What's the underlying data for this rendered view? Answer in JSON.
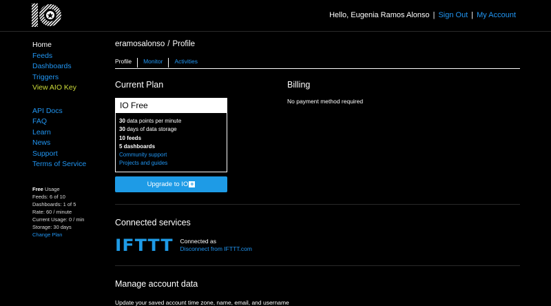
{
  "header": {
    "greeting": "Hello, Eugenia Ramos Alonso",
    "sign_out": "Sign Out",
    "my_account": "My Account",
    "separator": "|"
  },
  "sidebar": {
    "nav": [
      {
        "label": "Home"
      },
      {
        "label": "Feeds"
      },
      {
        "label": "Dashboards"
      },
      {
        "label": "Triggers"
      },
      {
        "label": "View AIO Key"
      }
    ],
    "nav2": [
      {
        "label": "API Docs"
      },
      {
        "label": "FAQ"
      },
      {
        "label": "Learn"
      },
      {
        "label": "News"
      },
      {
        "label": "Support"
      },
      {
        "label": "Terms of Service"
      }
    ],
    "usage": {
      "plan": "Free",
      "title": "Usage",
      "feeds": "Feeds: 6 of 10",
      "dashboards": "Dashboards: 1 of 5",
      "rate": "Rate: 60 / minute",
      "current": "Current Usage: 0 / min",
      "storage": "Storage: 30 days",
      "change_plan": "Change Plan"
    }
  },
  "main": {
    "breadcrumb": {
      "user": "eramosalonso",
      "slash": "/",
      "page": "Profile"
    },
    "tabs": [
      {
        "label": "Profile"
      },
      {
        "label": "Monitor"
      },
      {
        "label": "Activities"
      }
    ],
    "plan": {
      "section_title": "Current Plan",
      "name": "IO Free",
      "features": [
        {
          "bold": "30",
          "text": " data points per minute"
        },
        {
          "bold": "30",
          "text": " days of data storage"
        },
        {
          "bold": "10 feeds",
          "text": ""
        },
        {
          "bold": "5 dashboards",
          "text": ""
        }
      ],
      "links": [
        "Community support",
        "Projects and guides"
      ],
      "upgrade_label": "Upgrade to IO",
      "upgrade_plus": "+"
    },
    "billing": {
      "section_title": "Billing",
      "note": "No payment method required"
    },
    "connected": {
      "section_title": "Connected services",
      "service_logo": "IFTTT",
      "connected_as": "Connected as",
      "disconnect": "Disconnect from IFTTT.com"
    },
    "manage": {
      "section_title": "Manage account data",
      "subtitle": "Update your saved account time zone, name, email, and username"
    }
  },
  "colors": {
    "accent": "#2196f3",
    "aio_key": "#cddc39",
    "background": "#000000"
  }
}
